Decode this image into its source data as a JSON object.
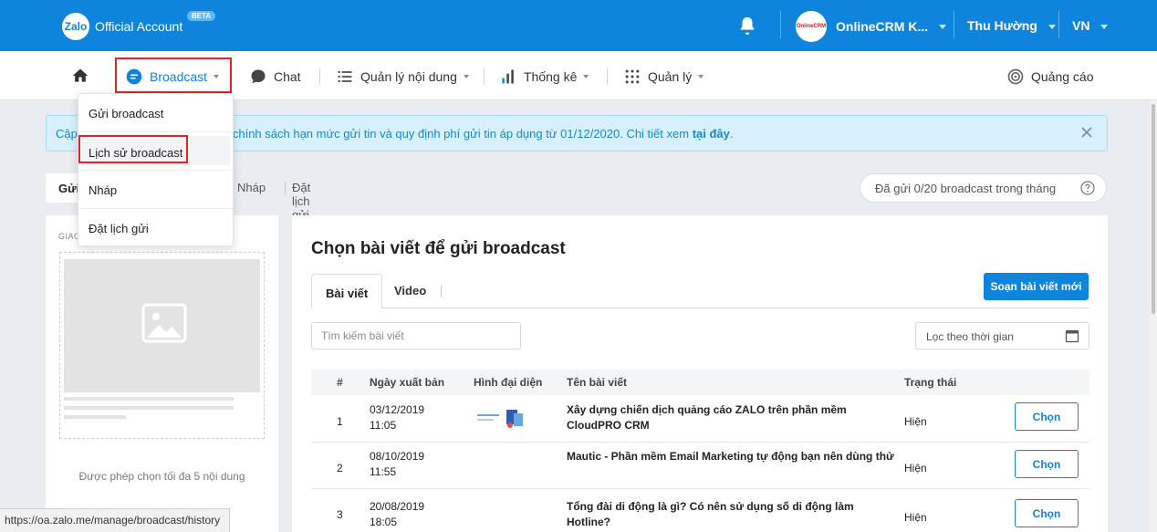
{
  "topbar": {
    "brand_badge": "Zalo",
    "brand_text": "Official Account",
    "beta_label": "BETA",
    "account_name": "OnlineCRM K...",
    "account_avatar_text": "OnlineCRM",
    "user_name": "Thu Hường",
    "language": "VN"
  },
  "nav": {
    "broadcast": "Broadcast",
    "chat": "Chat",
    "content": "Quản lý nội dung",
    "stats": "Thống kê",
    "manage": "Quản lý",
    "ads": "Quảng cáo"
  },
  "dropdown": {
    "items": [
      "Gửi broadcast",
      "Lịch sử broadcast",
      "Nháp",
      "Đặt lịch gửi"
    ]
  },
  "notice": {
    "prefix": "Cập",
    "text": "chính sách hạn mức gửi tin và quy định phí gửi tin áp dụng từ 01/12/2020. Chi tiết xem ",
    "link": "tại đây",
    "suffix": "."
  },
  "subtabs": {
    "send": "Gửi",
    "draft": "Nháp",
    "scheduled": "Đặt lịch gửi"
  },
  "sent_count": "Đã gửi 0/20 broadcast trong tháng",
  "left_panel": {
    "label": "GIAO",
    "caption": "Được phép chọn tối đa 5 nội dung"
  },
  "main": {
    "title": "Chọn bài viết để gửi broadcast",
    "tab_posts": "Bài viết",
    "tab_video": "Video",
    "new_post_button": "Soạn bài viết mới",
    "search_placeholder": "Tìm kiếm bài viết",
    "date_filter": "Lọc theo thời gian",
    "columns": [
      "#",
      "Ngày xuất bản",
      "Hình đại diện",
      "Tên bài viết",
      "Trạng thái"
    ],
    "rows": [
      {
        "num": "1",
        "date": "03/12/2019",
        "time": "11:05",
        "title": "Xây dựng chiến dịch quảng cáo ZALO trên phần mềm CloudPRO CRM",
        "status": "Hiện",
        "action": "Chọn"
      },
      {
        "num": "2",
        "date": "08/10/2019",
        "time": "11:55",
        "title": "Mautic - Phần mềm Email Marketing tự động bạn nên dùng thử",
        "status": "Hiện",
        "action": "Chọn"
      },
      {
        "num": "3",
        "date": "20/08/2019",
        "time": "18:05",
        "title": "Tổng đài di động là gì? Có nên sử dụng số di động làm Hotline?",
        "status": "Hiện",
        "action": "Chọn"
      }
    ]
  },
  "status_url": "https://oa.zalo.me/manage/broadcast/history",
  "colors": {
    "brand": "#0f84dc",
    "highlight": "#e0242a"
  }
}
